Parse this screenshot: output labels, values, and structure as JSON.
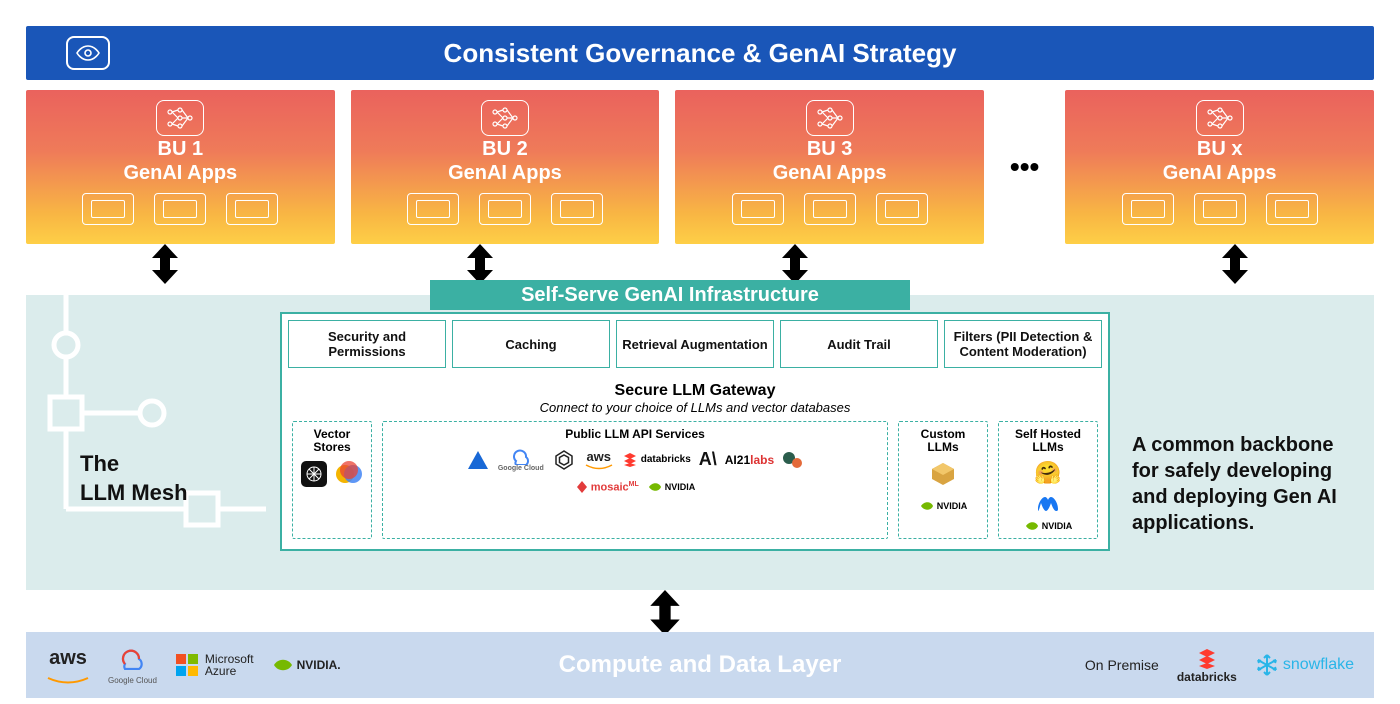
{
  "governance": {
    "title": "Consistent Governance & GenAI Strategy"
  },
  "bu_cards": [
    {
      "title": "BU 1",
      "subtitle": "GenAI Apps"
    },
    {
      "title": "BU 2",
      "subtitle": "GenAI Apps"
    },
    {
      "title": "BU 3",
      "subtitle": "GenAI Apps"
    },
    {
      "title": "BU x",
      "subtitle": "GenAI Apps"
    }
  ],
  "ellipsis": "•••",
  "selfserve_title": "Self-Serve GenAI Infrastructure",
  "infra_chips": [
    "Security and Permissions",
    "Caching",
    "Retrieval Augmentation",
    "Audit Trail",
    "Filters (PII Detection & Content Moderation)"
  ],
  "gateway": {
    "title": "Secure LLM Gateway",
    "subtitle": "Connect to your choice of LLMs and vector databases",
    "columns": {
      "vector": "Vector Stores",
      "public": "Public LLM API Services",
      "custom": "Custom LLMs",
      "selfhosted": "Self Hosted LLMs"
    },
    "public_logos": [
      "Azure",
      "Google Cloud",
      "OpenAI",
      "aws",
      "databricks",
      "Anthropic",
      "AI21 labs",
      "Cohere",
      "mosaicML",
      "NVIDIA"
    ],
    "custom_logos": [
      "AWS",
      "NVIDIA"
    ],
    "selfhosted_logos": [
      "Hugging Face",
      "Meta",
      "NVIDIA"
    ],
    "vector_logos": [
      "Pinecone",
      "Chroma"
    ]
  },
  "mesh_title_line1": "The",
  "mesh_title_line2": "LLM Mesh",
  "backbone_text": "A common backbone for safely developing and deploying Gen AI applications.",
  "compute": {
    "title": "Compute and Data Layer",
    "left": [
      "aws",
      "Google Cloud",
      "Microsoft Azure",
      "NVIDIA"
    ],
    "on_premise": "On Premise",
    "right": [
      "databricks",
      "snowflake"
    ]
  }
}
